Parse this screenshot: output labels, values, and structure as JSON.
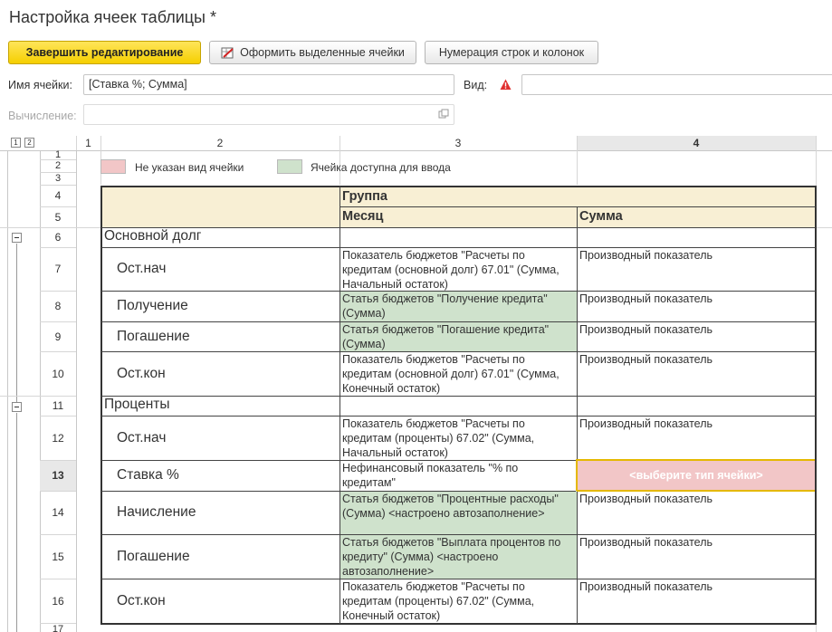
{
  "title": "Настройка ячеек таблицы *",
  "toolbar": {
    "finish_label": "Завершить редактирование",
    "format_label": "Оформить выделенные ячейки",
    "numbering_label": "Нумерация строк и колонок"
  },
  "form": {
    "cell_name_label": "Имя ячейки:",
    "cell_name_value": "[Ставка %; Сумма]",
    "view_label": "Вид:",
    "view_value": "",
    "calc_label": "Вычисление:",
    "calc_value": ""
  },
  "grid": {
    "level_buttons": [
      "1",
      "2"
    ],
    "columns": [
      "1",
      "2",
      "3",
      "4"
    ],
    "rows": [
      "1",
      "2",
      "3",
      "4",
      "5",
      "6",
      "7",
      "8",
      "9",
      "10",
      "11",
      "12",
      "13",
      "14",
      "15",
      "16",
      "17"
    ],
    "selected_row": "13",
    "selected_column": "4"
  },
  "legend": {
    "not_set": "Не указан вид ячейки",
    "input": "Ячейка доступна для ввода"
  },
  "table": {
    "header_group": "Группа",
    "header_month": "Месяц",
    "header_sum": "Сумма",
    "rows": [
      {
        "label": "Основной долг",
        "month": "",
        "sum": ""
      },
      {
        "label": "Ост.нач",
        "month": "Показатель бюджетов \"Расчеты по кредитам (основной долг) 67.01\" (Сумма, Начальный остаток)",
        "sum": "Производный показатель"
      },
      {
        "label": "Получение",
        "month": "Статья бюджетов \"Получение кредита\" (Сумма)",
        "sum": "Производный показатель"
      },
      {
        "label": "Погашение",
        "month": "Статья бюджетов \"Погашение кредита\" (Сумма)",
        "sum": "Производный показатель"
      },
      {
        "label": "Ост.кон",
        "month": "Показатель бюджетов \"Расчеты по кредитам (основной долг) 67.01\" (Сумма, Конечный остаток)",
        "sum": "Производный показатель"
      },
      {
        "label": "Проценты",
        "month": "",
        "sum": ""
      },
      {
        "label": "Ост.нач",
        "month": "Показатель бюджетов \"Расчеты по кредитам (проценты) 67.02\" (Сумма, Начальный остаток)",
        "sum": "Производный показатель"
      },
      {
        "label": "Ставка %",
        "month": "Нефинансовый показатель \"% по кредитам\"",
        "sum": "<выберите тип ячейки>"
      },
      {
        "label": "Начисление",
        "month": "Статья бюджетов \"Процентные расходы\" (Сумма) <настроено автозаполнение>",
        "sum": "Производный показатель"
      },
      {
        "label": "Погашение",
        "month": "Статья бюджетов \"Выплата процентов по кредиту\" (Сумма) <настроено автозаполнение>",
        "sum": "Производный показатель"
      },
      {
        "label": "Ост.кон",
        "month": "Показатель бюджетов \"Расчеты по кредитам (проценты) 67.02\" (Сумма, Конечный остаток)",
        "sum": "Производный показатель"
      }
    ]
  },
  "colors": {
    "primary_button": "#f5cf00",
    "input_cell": "#cfe2cc",
    "unset_cell": "#f2c6c7",
    "header_bg": "#f8efd4",
    "selected_border": "#e5b800",
    "warning": "#e03030"
  },
  "icons": [
    "format-cells-icon",
    "warning-icon",
    "calc-open-icon",
    "collapse-group-icon"
  ]
}
